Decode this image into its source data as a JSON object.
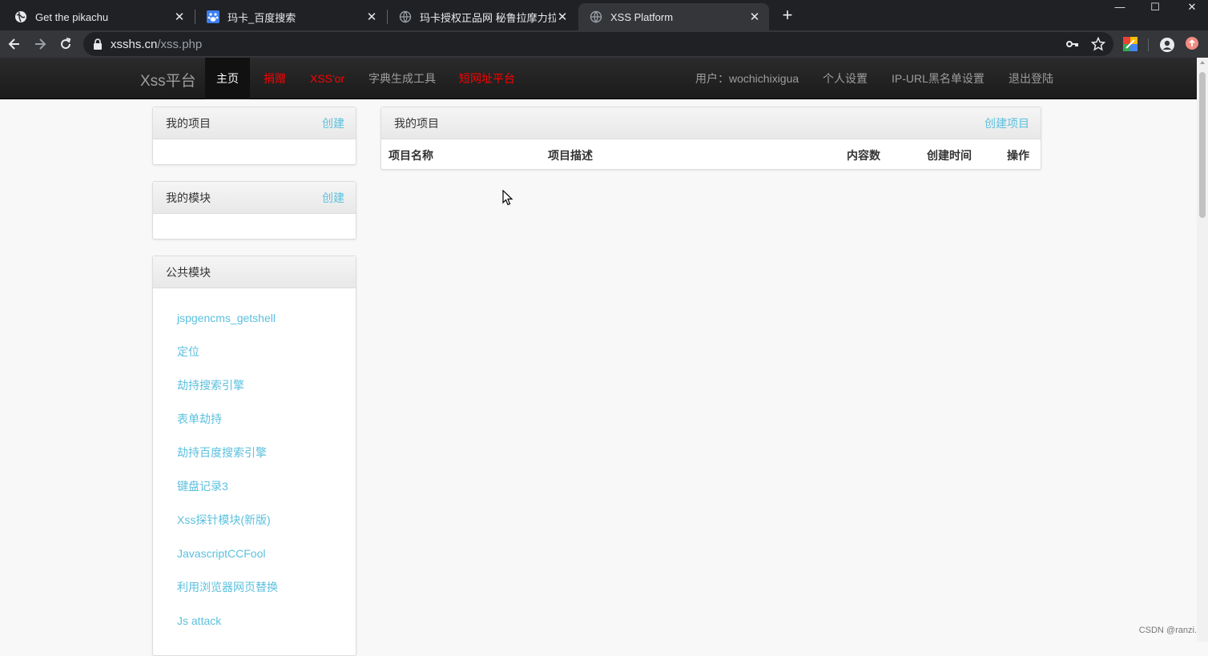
{
  "browser": {
    "tabs": [
      {
        "title": "Get the pikachu",
        "icon": "globe-icon",
        "active": false
      },
      {
        "title": "玛卡_百度搜索",
        "icon": "baidu-icon",
        "active": false
      },
      {
        "title": "玛卡授权正品网 秘鲁拉摩力拉玛",
        "icon": "globe-icon",
        "active": false
      },
      {
        "title": "XSS Platform",
        "icon": "globe-icon",
        "active": true
      }
    ],
    "new_tab": "+",
    "window_controls": {
      "minimize": "—",
      "maximize": "☐",
      "close": "✕"
    },
    "url": {
      "host": "xsshs.cn",
      "path": "/xss.php"
    }
  },
  "site": {
    "brand": "Xss平台",
    "nav": [
      {
        "label": "主页",
        "active": true,
        "red": false
      },
      {
        "label": "捐赠",
        "active": false,
        "red": true
      },
      {
        "label": "XSS'or",
        "active": false,
        "red": true
      },
      {
        "label": "字典生成工具",
        "active": false,
        "red": false
      },
      {
        "label": "短网址平台",
        "active": false,
        "red": true
      }
    ],
    "user_nav": [
      {
        "label": "用户：wochichixigua"
      },
      {
        "label": "个人设置"
      },
      {
        "label": "IP-URL黑名单设置"
      },
      {
        "label": "退出登陆"
      }
    ]
  },
  "sidebar": {
    "my_projects": {
      "title": "我的项目",
      "action": "创建"
    },
    "my_modules": {
      "title": "我的模块",
      "action": "创建"
    },
    "public_modules": {
      "title": "公共模块",
      "items": [
        "jspgencms_getshell",
        "定位",
        "劫持搜索引擎",
        "表单劫持",
        "劫持百度搜索引擎",
        "键盘记录3",
        "Xss探针模块(新版)",
        "JavascriptCCFool",
        "利用浏览器网页替换",
        "Js attack"
      ]
    }
  },
  "main": {
    "title": "我的项目",
    "action": "创建项目",
    "columns": [
      "项目名称",
      "项目描述",
      "内容数",
      "创建时间",
      "操作"
    ]
  },
  "watermark": "CSDN @ranzi.",
  "colors": {
    "accent_link": "#5bc0de",
    "nav_red": "#ff0000",
    "nav_bg": "#222222"
  }
}
